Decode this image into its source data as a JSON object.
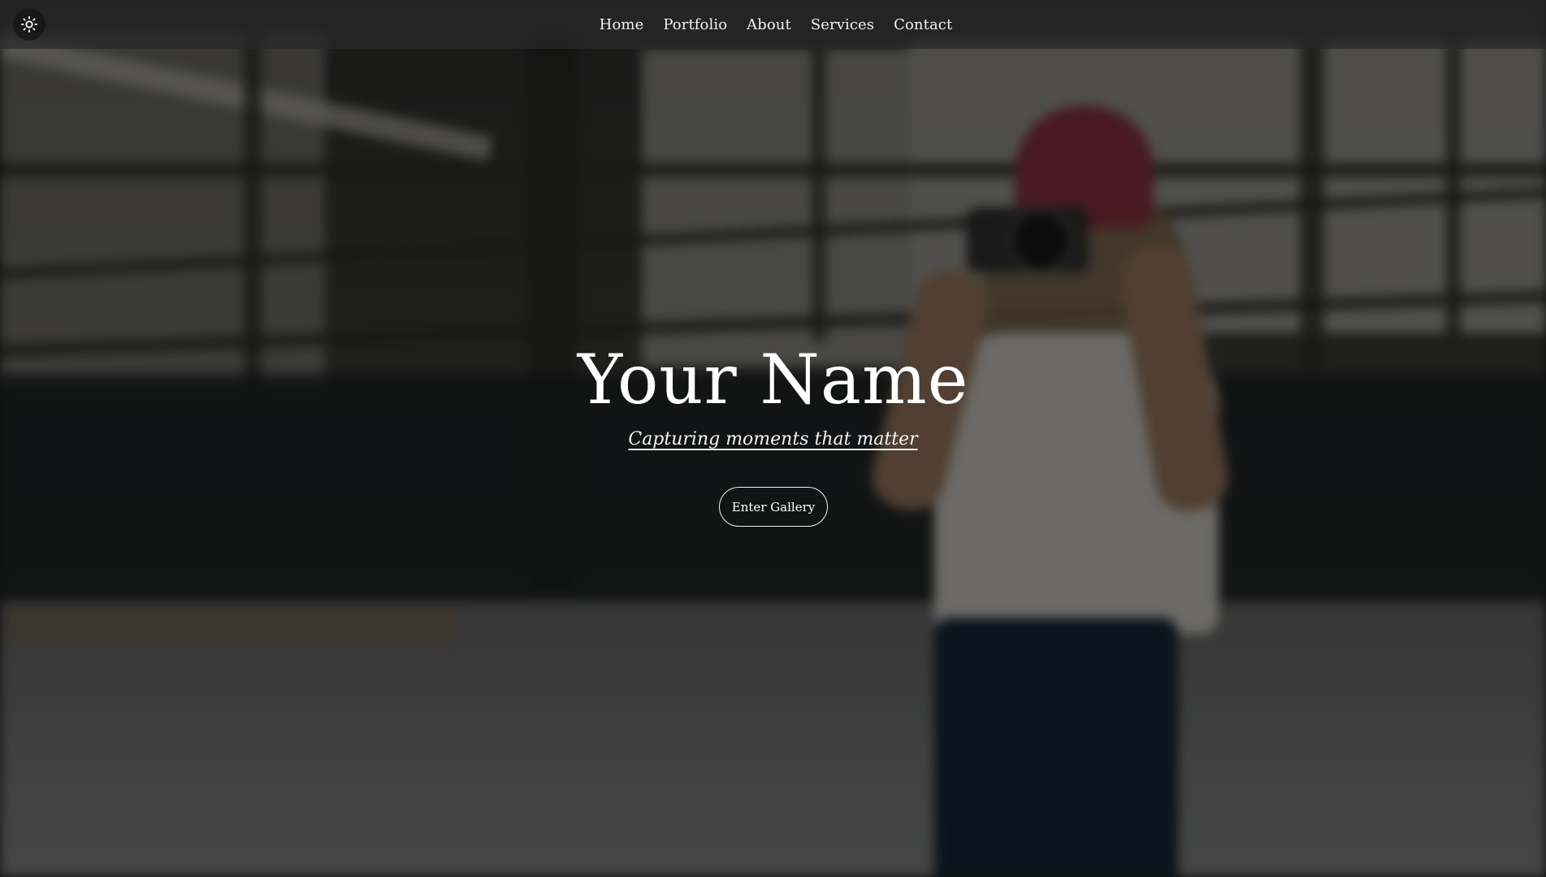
{
  "nav": {
    "theme_toggle_icon": "sun-icon",
    "links": [
      {
        "label": "Home"
      },
      {
        "label": "Portfolio"
      },
      {
        "label": "About"
      },
      {
        "label": "Services"
      },
      {
        "label": "Contact"
      }
    ]
  },
  "hero": {
    "title": "Your Name",
    "tagline": "Capturing moments that matter",
    "cta_label": "Enter Gallery",
    "background_image": "blurred-photo-woman-with-camera-in-warehouse"
  },
  "colors": {
    "text": "#ffffff",
    "navbar_bg": "#282828",
    "overlay": "#000000"
  }
}
